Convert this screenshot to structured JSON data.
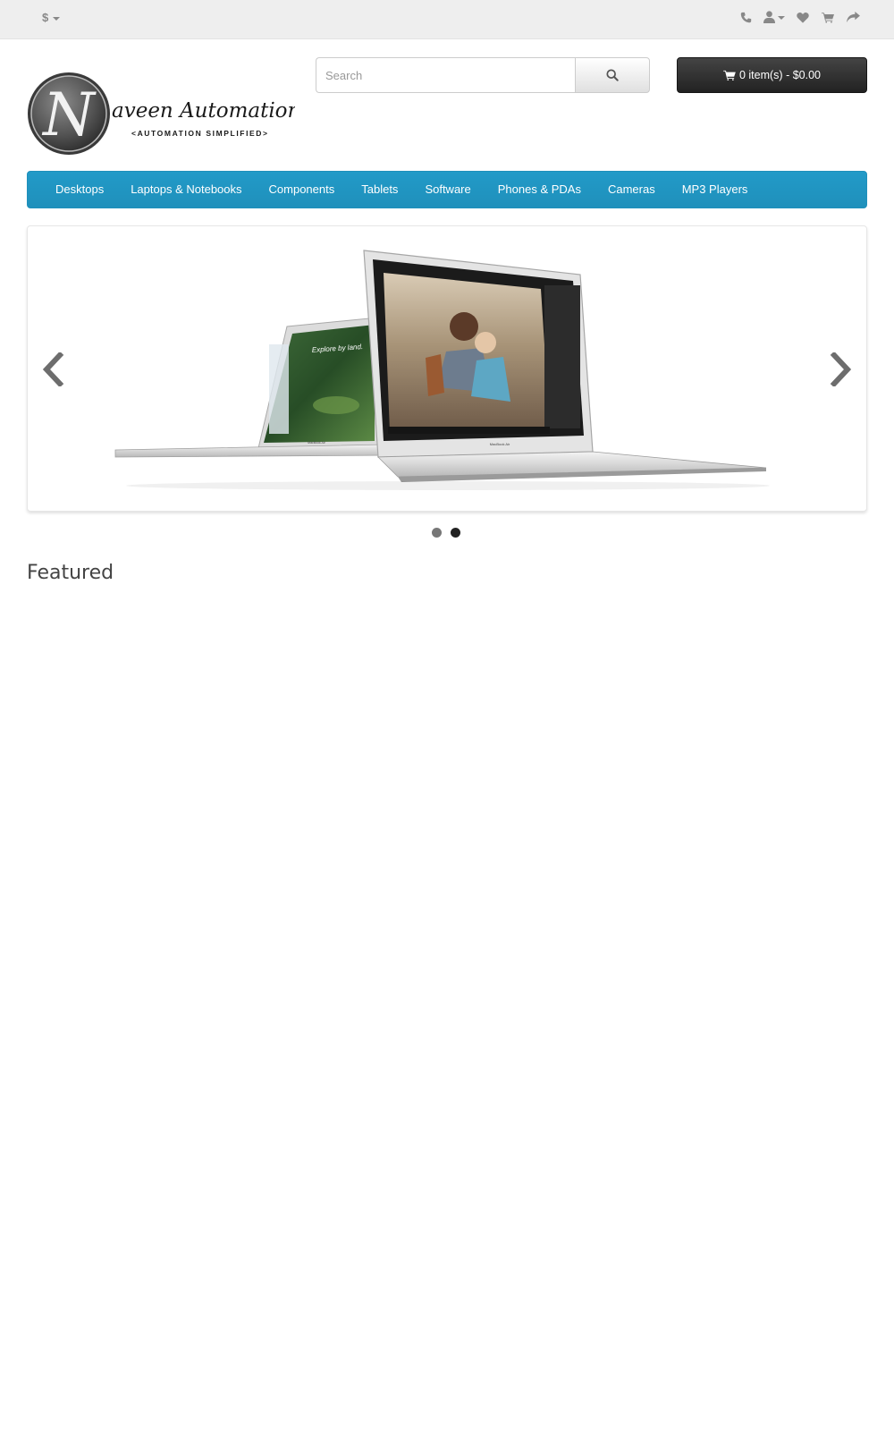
{
  "topbar": {
    "currency_symbol": "$",
    "icons": [
      "phone-icon",
      "user-icon",
      "heart-icon",
      "shopping-cart-icon",
      "share-icon"
    ]
  },
  "logo": {
    "monogram": "N",
    "script_text": "aveen Automation Labs",
    "tagline": "<AUTOMATION SIMPLIFIED>"
  },
  "search": {
    "placeholder": "Search",
    "value": ""
  },
  "cart": {
    "label": "0 item(s) - $0.00"
  },
  "menu": {
    "items": [
      {
        "label": "Desktops"
      },
      {
        "label": "Laptops & Notebooks"
      },
      {
        "label": "Components"
      },
      {
        "label": "Tablets"
      },
      {
        "label": "Software"
      },
      {
        "label": "Phones & PDAs"
      },
      {
        "label": "Cameras"
      },
      {
        "label": "MP3 Players"
      }
    ]
  },
  "slideshow": {
    "slide_count": 2,
    "active_index": 1,
    "image_text": {
      "small_screen_heading": "Explore by land.",
      "left_laptop_brand": "MacBook Air",
      "right_laptop_brand": "MacBook Air"
    }
  },
  "section": {
    "featured_title": "Featured"
  },
  "colors": {
    "menu_blue": "#229ac8",
    "cart_dark": "#333333",
    "topbar_gray": "#eeeeee"
  }
}
